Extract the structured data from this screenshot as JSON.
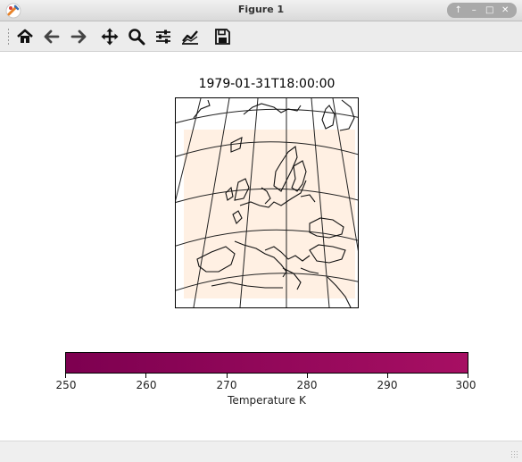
{
  "window": {
    "title": "Figure 1",
    "controls": [
      "↑",
      "–",
      "□",
      "✕"
    ]
  },
  "toolbar": {
    "buttons": [
      {
        "name": "home",
        "icon": "home-icon"
      },
      {
        "name": "back",
        "icon": "arrow-left-icon"
      },
      {
        "name": "forward",
        "icon": "arrow-right-icon"
      },
      {
        "name": "pan",
        "icon": "move-icon"
      },
      {
        "name": "zoom",
        "icon": "magnifier-icon"
      },
      {
        "name": "configure-subplots",
        "icon": "sliders-icon"
      },
      {
        "name": "edit-axis",
        "icon": "line-chart-icon"
      },
      {
        "name": "save",
        "icon": "floppy-disk-icon"
      }
    ]
  },
  "figure": {
    "map_title": "1979-01-31T18:00:00",
    "map_fill_color": "#fff0e3",
    "colorbar": {
      "label": "Temperature K",
      "min": 250,
      "max": 300,
      "ticks": [
        "250",
        "260",
        "270",
        "280",
        "290",
        "300"
      ],
      "colors": [
        "#7d0050",
        "#a70f63"
      ]
    }
  }
}
